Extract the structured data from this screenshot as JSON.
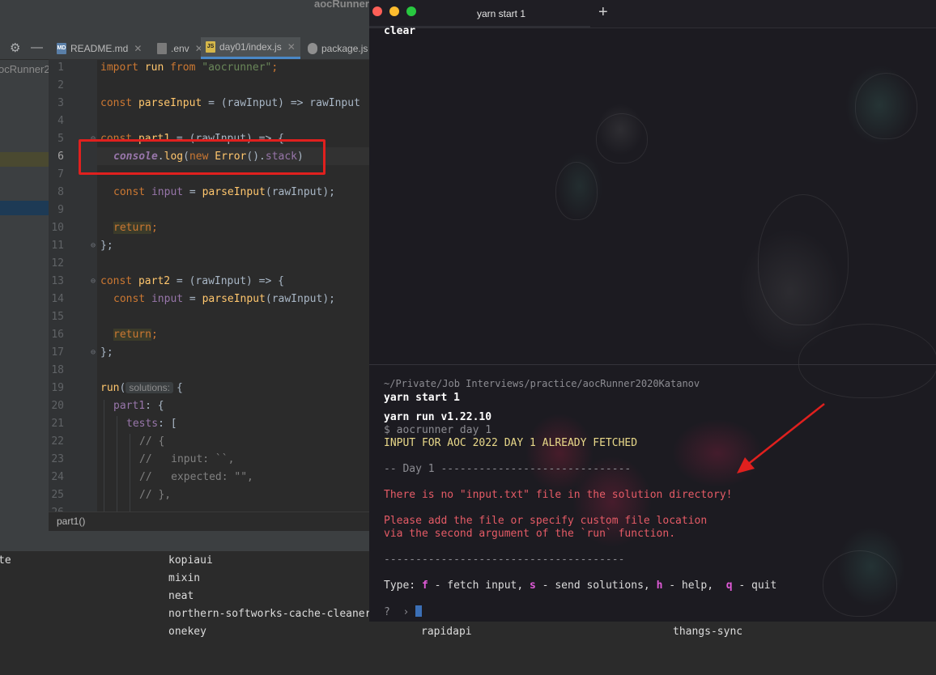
{
  "ide": {
    "window_title": "aocRunner",
    "project_root_label": "ocRunner2",
    "tabs": [
      {
        "label": "README.md",
        "icon": "markdown-file-icon"
      },
      {
        "label": ".env",
        "icon": "env-file-icon"
      },
      {
        "label": "day01/index.js",
        "icon": "js-file-icon",
        "active": true
      },
      {
        "label": "package.js",
        "icon": "package-json-icon"
      }
    ],
    "line_numbers": [
      "1",
      "2",
      "3",
      "4",
      "5",
      "6",
      "7",
      "8",
      "9",
      "10",
      "11",
      "12",
      "13",
      "14",
      "15",
      "16",
      "17",
      "18",
      "19",
      "20",
      "21",
      "22",
      "23",
      "24",
      "25",
      "26"
    ],
    "current_line": "6",
    "code": {
      "l1": {
        "kw": "import",
        "fn": "run",
        "kw2": "from",
        "str": "\"aocrunner\"",
        "end": ";"
      },
      "l3": {
        "kw": "const",
        "fn": "parseInput",
        "mid": " = (rawInput) => rawInput"
      },
      "l5": {
        "kw": "const",
        "fn": "part1",
        "mid": " = (rawInput) => {"
      },
      "l6": {
        "obj": "console",
        "dot": ".",
        "fn": "log",
        "p1": "(",
        "kw": "new",
        "cls": "Error",
        "p2": "().",
        "prop": "stack",
        "end": ")"
      },
      "l8": {
        "kw": "const",
        "var": "input",
        "mid": " = ",
        "fn": "parseInput",
        "end": "(rawInput);"
      },
      "l10": {
        "kw": "return",
        "end": ";"
      },
      "l11": {
        "text": "};"
      },
      "l13": {
        "kw": "const",
        "fn": "part2",
        "mid": " = (rawInput) => {"
      },
      "l14": {
        "kw": "const",
        "var": "input",
        "mid": " = ",
        "fn": "parseInput",
        "end": "(rawInput);"
      },
      "l16": {
        "kw": "return",
        "end": ";"
      },
      "l17": {
        "text": "};"
      },
      "l20": {
        "fn": "run",
        "p1": "(",
        "hint": "solutions:",
        "end": "{"
      },
      "l21": {
        "prop": "part1",
        "end": ": {"
      },
      "l22": {
        "prop": "tests",
        "end": ": ["
      },
      "l23": {
        "cmt": "// {"
      },
      "l24": {
        "cmt": "//   input: ``,"
      },
      "l25": {
        "cmt": "//   expected: \"\","
      },
      "l26": {
        "cmt": "// },"
      }
    },
    "breadcrumb": "part1()",
    "packages_col1": [
      "te"
    ],
    "packages_col2": [
      "kopiaui",
      "mixin",
      "neat",
      "northern-softworks-cache-cleaner",
      "onekey"
    ],
    "packages_row_extra": [
      "rapidapi",
      "thangs-sync"
    ]
  },
  "terminal": {
    "tab_label": "yarn start 1",
    "new_tab": "+",
    "top_command": "clear",
    "cwd": "~/Private/Job Interviews/practice/aocRunner2020Katanov",
    "command": "yarn start 1",
    "yarn_version": "yarn run v1.22.10",
    "runner_cmd": "$ aocrunner day 1",
    "fetched_msg": "INPUT FOR AOC 2022 DAY 1 ALREADY FETCHED",
    "day_header": "-- Day 1 ------------------------------",
    "error_msg": "There is no \"input.txt\" file in the solution directory!",
    "hint_line1": "Please add the file or specify custom file location",
    "hint_line2": "via the second argument of the `run` function.",
    "separator": "--------------------------------------",
    "help": {
      "prefix": "Type: ",
      "f_key": "f",
      "f_text": " - fetch input, ",
      "s_key": "s",
      "s_text": " - send solutions, ",
      "h_key": "h",
      "h_text": " - help,  ",
      "q_key": "q",
      "q_text": " - quit"
    },
    "prompt": "?",
    "prompt_arrow": "›"
  },
  "colors": {
    "annotation_red": "#e0201e",
    "accent_blue": "#4a88c7"
  }
}
